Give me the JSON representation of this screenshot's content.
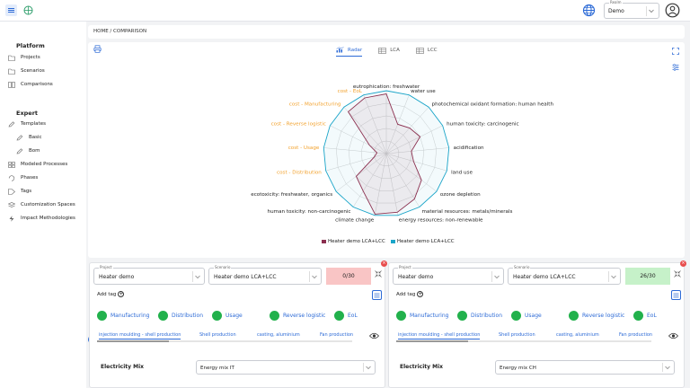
{
  "realm": {
    "label": "Realm",
    "value": "Demo"
  },
  "sidebar": {
    "sections": [
      {
        "title": "Platform",
        "items": [
          {
            "label": "Projects",
            "icon": "folder-icon"
          },
          {
            "label": "Scenarios",
            "icon": "folder-icon"
          },
          {
            "label": "Comparisons",
            "icon": "compare-icon"
          }
        ]
      },
      {
        "title": "Expert",
        "items": [
          {
            "label": "Templates",
            "icon": "edit-icon"
          },
          {
            "label": "Basic",
            "icon": "edit-icon"
          },
          {
            "label": "Bom",
            "icon": "edit-icon"
          },
          {
            "label": "Modeled Processes",
            "icon": "grid-icon"
          },
          {
            "label": "Phases",
            "icon": "cycle-icon"
          },
          {
            "label": "Tags",
            "icon": "tag-icon"
          },
          {
            "label": "Customization Spaces",
            "icon": "stack-icon"
          },
          {
            "label": "Impact Methodologies",
            "icon": "bolt-icon"
          }
        ]
      }
    ]
  },
  "breadcrumb": "HOME / COMPARISON",
  "tabs": [
    {
      "label": "Radar",
      "active": true,
      "icon": "radar-icon"
    },
    {
      "label": "LCA",
      "active": false,
      "icon": "table-icon"
    },
    {
      "label": "LCC",
      "active": false,
      "icon": "table-icon"
    }
  ],
  "chart_data": {
    "type": "radar",
    "axes": [
      {
        "label": "eutrophication: freshwater",
        "group": "lca"
      },
      {
        "label": "water use",
        "group": "lca"
      },
      {
        "label": "photochemical oxidant formation: human health",
        "group": "lca"
      },
      {
        "label": "human toxicity: carcinogenic",
        "group": "lca"
      },
      {
        "label": "acidification",
        "group": "lca"
      },
      {
        "label": "land use",
        "group": "lca"
      },
      {
        "label": "ozone depletion",
        "group": "lca"
      },
      {
        "label": "material resources: metals/minerals",
        "group": "lca"
      },
      {
        "label": "energy resources: non-renewable",
        "group": "lca"
      },
      {
        "label": "climate change",
        "group": "lca"
      },
      {
        "label": "human toxicity: non-carcinogenic",
        "group": "lca"
      },
      {
        "label": "ecotoxicity: freshwater, organics",
        "group": "lca"
      },
      {
        "label": "cost - Distribution",
        "group": "lcc"
      },
      {
        "label": "cost - Usage",
        "group": "lcc"
      },
      {
        "label": "cost - Reverse logistic",
        "group": "lcc"
      },
      {
        "label": "cost - Manufacturing",
        "group": "lcc"
      },
      {
        "label": "cost - EoL",
        "group": "lcc"
      }
    ],
    "series": [
      {
        "name": "Heater demo LCA+LCC",
        "color": "#8b2f4f",
        "values": [
          0.95,
          0.5,
          0.55,
          0.6,
          0.4,
          0.45,
          0.7,
          0.85,
          0.95,
          0.98,
          0.7,
          0.6,
          0.2,
          0.15,
          0.3,
          0.9,
          0.95
        ]
      },
      {
        "name": "Heater demo LCA+LCC",
        "color": "#1aa5c9",
        "values": [
          1,
          1,
          1,
          1,
          1,
          1,
          1,
          1,
          1,
          1,
          1,
          1,
          1,
          1,
          1,
          1,
          1
        ]
      }
    ],
    "rings": 5,
    "label_colors": {
      "lca": "#222222",
      "lcc": "#f2a12c"
    }
  },
  "cards": [
    {
      "project_label": "Project",
      "project": "Heater demo",
      "scenario_label": "Scenario",
      "scenario": "Heater demo LCA+LCC",
      "score": "0/30",
      "score_color": "#f9c5c5",
      "add_tag": "Add tag",
      "phases": [
        "Manufacturing",
        "Distribution",
        "Usage",
        "Reverse logistic",
        "EoL"
      ],
      "subtabs": [
        "injection moulding - shell production",
        "Shell production",
        "casting, aluminium",
        "Fan production"
      ],
      "electricity_label": "Electricity Mix",
      "electricity": "Energy mix IT"
    },
    {
      "project_label": "Project",
      "project": "Heater demo",
      "scenario_label": "Scenario",
      "scenario": "Heater demo LCA+LCC",
      "score": "26/30",
      "score_color": "#c6f1c9",
      "add_tag": "Add tag",
      "phases": [
        "Manufacturing",
        "Distribution",
        "Usage",
        "Reverse logistic",
        "EoL"
      ],
      "subtabs": [
        "injection moulding - shell production",
        "Shell production",
        "casting, aluminium",
        "Fan production"
      ],
      "electricity_label": "Electricity Mix",
      "electricity": "Energy mix CH"
    }
  ]
}
